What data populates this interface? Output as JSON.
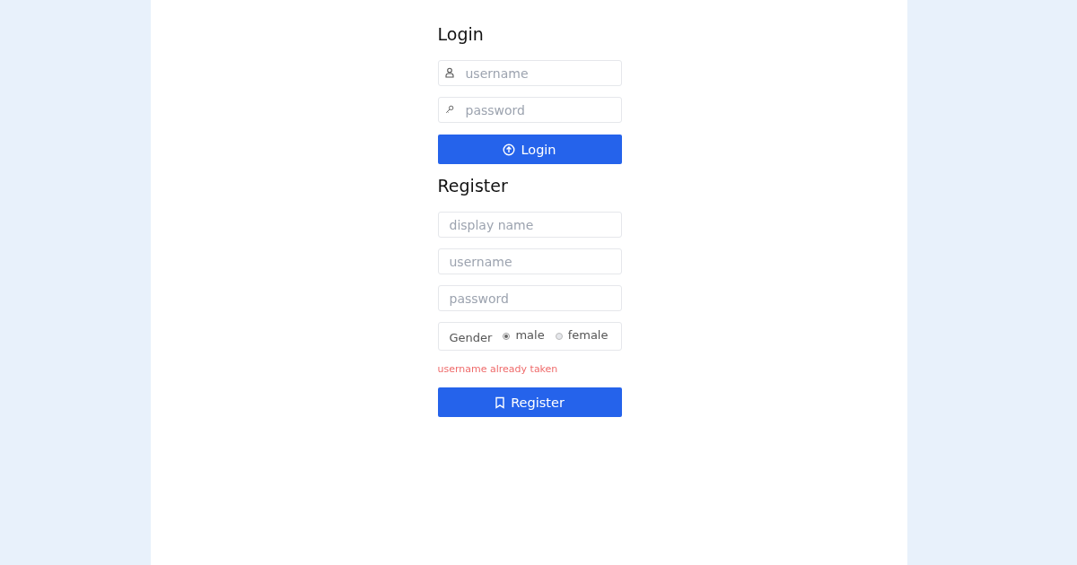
{
  "login": {
    "title": "Login",
    "fields": [
      {
        "kind": "user",
        "placeholder": "username"
      },
      {
        "kind": "key",
        "placeholder": "password"
      }
    ],
    "button": {
      "kind": "login",
      "label": "Login"
    }
  },
  "register": {
    "title": "Register",
    "fields": [
      {
        "placeholder": "display name"
      },
      {
        "placeholder": "username"
      },
      {
        "placeholder": "password"
      }
    ],
    "gender": {
      "label": "Gender",
      "options": [
        {
          "label": "male",
          "selected": true
        },
        {
          "label": "female",
          "selected": false
        }
      ]
    },
    "error": "username already taken",
    "button": {
      "kind": "register",
      "label": "Register"
    }
  }
}
